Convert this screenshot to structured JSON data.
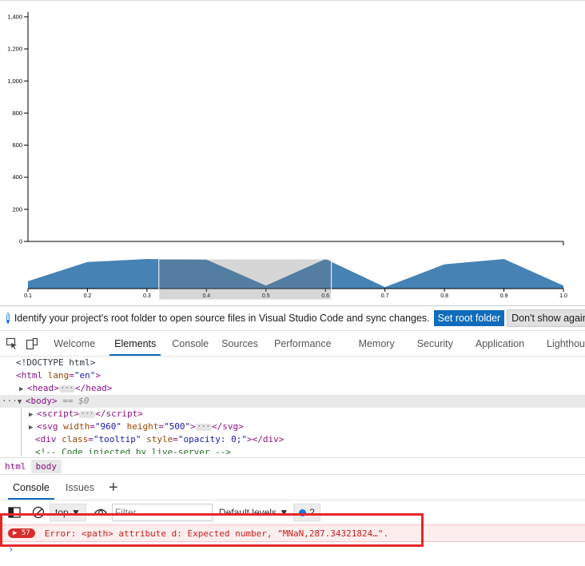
{
  "chart_data": [
    {
      "type": "area",
      "title": "",
      "xlabel": "",
      "ylabel": "",
      "y_ticks": [
        "0",
        "200",
        "400",
        "600",
        "800",
        "1,000",
        "1,200",
        "1,400"
      ],
      "ylim": [
        0,
        1400
      ],
      "x_axis_visible_labels": false,
      "series": [
        {
          "values": []
        }
      ]
    },
    {
      "type": "area",
      "title": "",
      "x_ticks": [
        "0.1",
        "0.2",
        "0.3",
        "0.4",
        "0.5",
        "0.6",
        "0.7",
        "0.8",
        "0.9",
        "1.0"
      ],
      "xlim": [
        0.1,
        1.0
      ],
      "ylim": [
        0,
        1
      ],
      "x": [
        0.1,
        0.2,
        0.3,
        0.4,
        0.5,
        0.6,
        0.7,
        0.8,
        0.9,
        1.0
      ],
      "y": [
        0.25,
        0.9,
        1.0,
        0.98,
        0.1,
        1.0,
        0.05,
        0.82,
        1.0,
        0.1
      ],
      "color": "#4682b4",
      "brush_selection": [
        0.32,
        0.61
      ]
    }
  ],
  "infobar": {
    "text": "Identify your project's root folder to open source files in Visual Studio Code and sync changes.",
    "set_root": "Set root folder",
    "dont_show": "Don't show again"
  },
  "devtools_tabs": [
    "Welcome",
    "Elements",
    "Console",
    "Sources",
    "Performance",
    "Memory",
    "Security",
    "Application",
    "Lighthou"
  ],
  "dom": {
    "doctype": "<!DOCTYPE html>",
    "html_open": "html",
    "lang_attr": "lang",
    "lang_val": "\"en\"",
    "head": "head",
    "body": "body",
    "dollar": "== $0",
    "script": "script",
    "svg": "svg",
    "svg_width_attr": "width",
    "svg_width_val": "\"960\"",
    "svg_height_attr": "height",
    "svg_height_val": "\"500\"",
    "div": "div",
    "div_class_attr": "class",
    "div_class_val": "\"tooltip\"",
    "div_style_attr": "style",
    "div_style_val": "\"opacity: 0;\"",
    "comment": "<!-- Code injected by live-server -->"
  },
  "breadcrumbs": [
    "html",
    "body"
  ],
  "drawer_tabs": [
    "Console",
    "Issues"
  ],
  "console_toolbar": {
    "context": "top",
    "filter_placeholder": "Filter",
    "levels": "Default levels",
    "issues_count": "2"
  },
  "error": {
    "count": "57",
    "message": "Error: <path> attribute d: Expected number, \"MNaN,287.34321824…\"."
  },
  "colors": {
    "accent": "#0f6cbd",
    "error": "#c4201c",
    "area": "#4682b4"
  }
}
